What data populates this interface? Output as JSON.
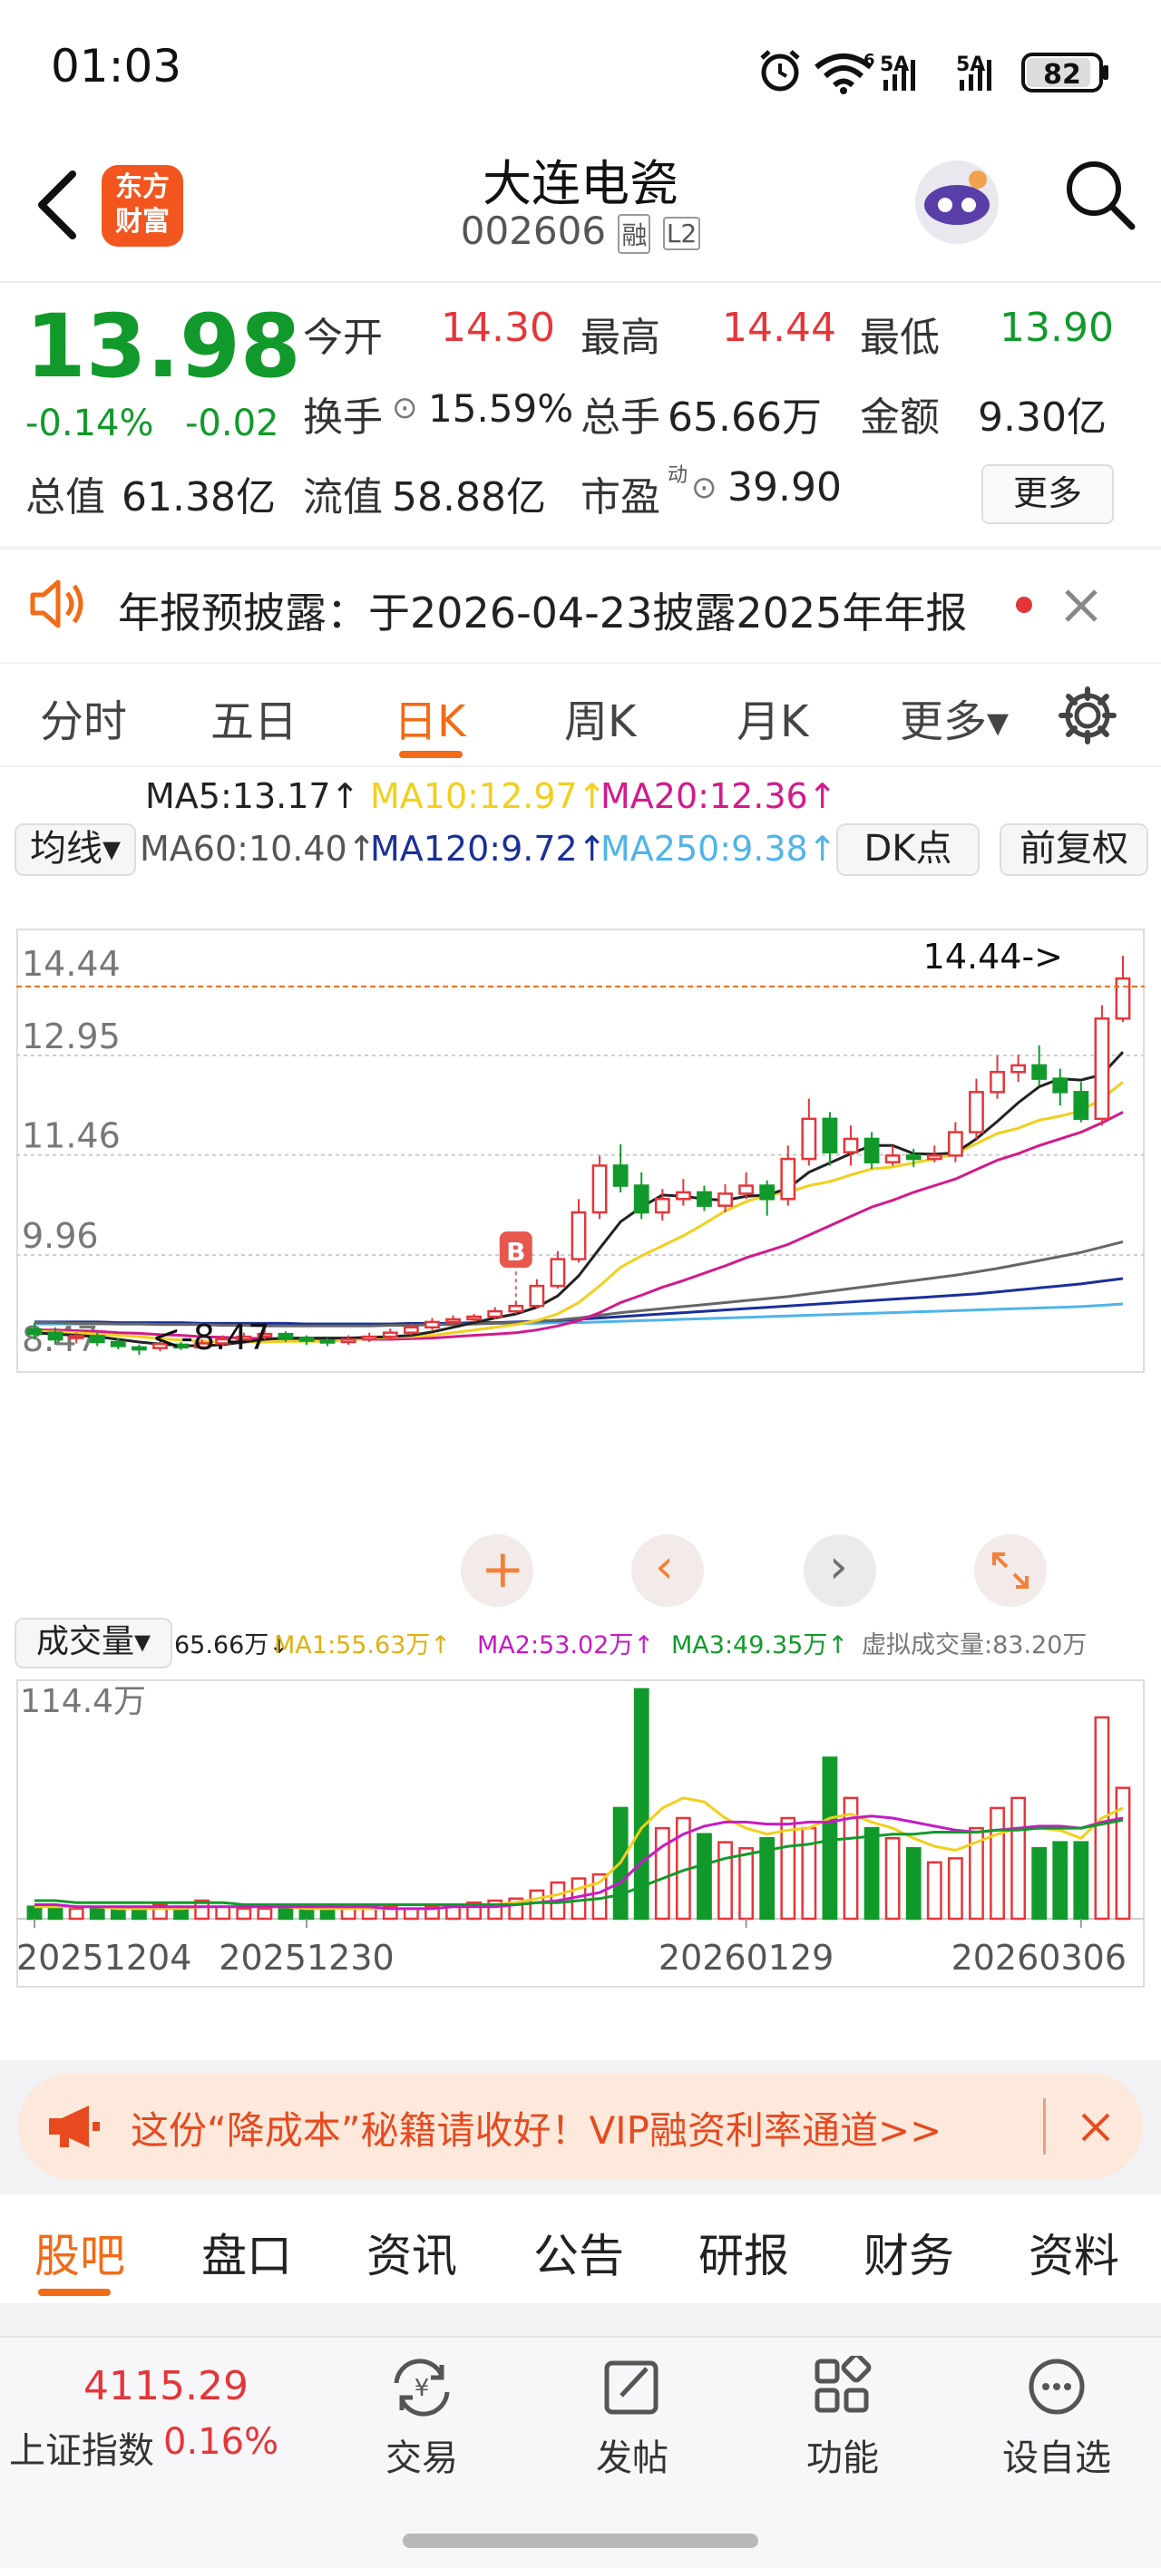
{
  "status_bar": {
    "time": "01:03",
    "battery": "82",
    "signal1": "5A",
    "signal2": "5A",
    "wifi_badge": "6"
  },
  "header": {
    "title": "大连电瓷",
    "code": "002606",
    "badge1": "融",
    "badge2": "L2",
    "logo_line1": "东方",
    "logo_line2": "财富"
  },
  "quote": {
    "price": "13.98",
    "change_pct": "-0.14%",
    "change": "-0.02",
    "open_label": "今开",
    "open": "14.30",
    "high_label": "最高",
    "high": "14.44",
    "low_label": "最低",
    "low": "13.90",
    "turnover_label": "换手",
    "turnover": "15.59%",
    "volume_label": "总手",
    "volume": "65.66万",
    "amount_label": "金额",
    "amount": "9.30亿",
    "mktcap_label": "总值",
    "mktcap": "61.38亿",
    "float_label": "流值",
    "float": "58.88亿",
    "pe_label": "市盈",
    "pe_sup": "动",
    "pe": "39.90",
    "more_button": "更多"
  },
  "notice": {
    "text": "年报预披露：于2026-04-23披露2025年年报"
  },
  "tabs": [
    "分时",
    "五日",
    "日K",
    "周K",
    "月K",
    "更多▾"
  ],
  "active_tab": 2,
  "ma_line1": {
    "ma5": "MA5:13.17↑",
    "ma10": "MA10:12.97↑",
    "ma20": "MA20:12.36↑"
  },
  "ma_line2": {
    "selector": "均线▾",
    "ma60": "MA60:10.40↑",
    "ma120": "MA120:9.72↑",
    "ma250": "MA250:9.38↑",
    "dk_button": "DK点",
    "adjust_button": "前复权"
  },
  "colors": {
    "up": "#e4363a",
    "down": "#119a2b",
    "ma5": "#222222",
    "ma10": "#f2cf1c",
    "ma20": "#d21a8c",
    "ma60": "#666666",
    "ma120": "#1a2f9a",
    "ma250": "#4fb4ea",
    "accent": "#f26b16"
  },
  "chart_data": {
    "type": "candlestick",
    "price_ticks": [
      "14.44",
      "12.95",
      "11.46",
      "9.96",
      "8.47"
    ],
    "ylim": [
      8.47,
      14.44
    ],
    "max_label": "14.44->",
    "min_label": "<-8.47",
    "buy_marker": "B",
    "candles": [
      [
        8.85,
        8.78,
        8.95,
        8.7
      ],
      [
        8.8,
        8.7,
        8.88,
        8.62
      ],
      [
        8.72,
        8.75,
        8.8,
        8.64
      ],
      [
        8.75,
        8.66,
        8.82,
        8.6
      ],
      [
        8.66,
        8.6,
        8.72,
        8.55
      ],
      [
        8.58,
        8.55,
        8.62,
        8.47
      ],
      [
        8.57,
        8.63,
        8.68,
        8.52
      ],
      [
        8.62,
        8.58,
        8.66,
        8.54
      ],
      [
        8.58,
        8.64,
        8.7,
        8.55
      ],
      [
        8.64,
        8.7,
        8.76,
        8.6
      ],
      [
        8.7,
        8.74,
        8.8,
        8.66
      ],
      [
        8.74,
        8.78,
        8.84,
        8.7
      ],
      [
        8.78,
        8.72,
        8.82,
        8.66
      ],
      [
        8.72,
        8.68,
        8.76,
        8.62
      ],
      [
        8.68,
        8.66,
        8.72,
        8.6
      ],
      [
        8.66,
        8.7,
        8.76,
        8.62
      ],
      [
        8.7,
        8.74,
        8.8,
        8.66
      ],
      [
        8.74,
        8.8,
        8.86,
        8.7
      ],
      [
        8.8,
        8.88,
        8.94,
        8.76
      ],
      [
        8.88,
        8.96,
        9.02,
        8.84
      ],
      [
        8.96,
        9.0,
        9.06,
        8.9
      ],
      [
        9.0,
        9.04,
        9.08,
        8.96
      ],
      [
        9.04,
        9.12,
        9.18,
        9.0
      ],
      [
        9.12,
        9.2,
        9.28,
        9.08
      ],
      [
        9.2,
        9.5,
        9.6,
        9.16
      ],
      [
        9.5,
        9.9,
        10.02,
        9.46
      ],
      [
        9.9,
        10.6,
        10.8,
        9.85
      ],
      [
        10.6,
        11.3,
        11.45,
        10.5
      ],
      [
        11.3,
        11.0,
        11.62,
        10.9
      ],
      [
        11.0,
        10.6,
        11.2,
        10.5
      ],
      [
        10.6,
        10.8,
        10.95,
        10.48
      ],
      [
        10.8,
        10.9,
        11.1,
        10.7
      ],
      [
        10.9,
        10.7,
        11.0,
        10.62
      ],
      [
        10.7,
        10.88,
        11.02,
        10.6
      ],
      [
        10.88,
        11.0,
        11.2,
        10.8
      ],
      [
        11.0,
        10.8,
        11.08,
        10.55
      ],
      [
        10.8,
        11.4,
        11.6,
        10.7
      ],
      [
        11.4,
        12.0,
        12.3,
        11.3
      ],
      [
        12.0,
        11.5,
        12.1,
        11.3
      ],
      [
        11.5,
        11.7,
        11.9,
        11.3
      ],
      [
        11.7,
        11.35,
        11.8,
        11.25
      ],
      [
        11.35,
        11.45,
        11.6,
        11.3
      ],
      [
        11.45,
        11.4,
        11.55,
        11.28
      ],
      [
        11.4,
        11.45,
        11.6,
        11.35
      ],
      [
        11.45,
        11.8,
        11.95,
        11.35
      ],
      [
        11.8,
        12.4,
        12.6,
        11.7
      ],
      [
        12.4,
        12.7,
        12.95,
        12.3
      ],
      [
        12.7,
        12.8,
        12.96,
        12.55
      ],
      [
        12.8,
        12.6,
        13.1,
        12.5
      ],
      [
        12.6,
        12.4,
        12.75,
        12.2
      ],
      [
        12.4,
        12.0,
        12.55,
        11.95
      ],
      [
        12.0,
        13.5,
        13.7,
        11.9
      ],
      [
        13.5,
        14.1,
        14.44,
        13.45
      ]
    ],
    "ma5": [
      8.8,
      8.78,
      8.76,
      8.74,
      8.7,
      8.66,
      8.63,
      8.61,
      8.6,
      8.62,
      8.66,
      8.7,
      8.72,
      8.72,
      8.72,
      8.72,
      8.73,
      8.74,
      8.76,
      8.81,
      8.88,
      8.95,
      9.02,
      9.08,
      9.18,
      9.35,
      9.65,
      10.06,
      10.46,
      10.68,
      10.86,
      10.84,
      10.8,
      10.78,
      10.84,
      10.86,
      10.96,
      11.2,
      11.34,
      11.48,
      11.6,
      11.6,
      11.48,
      11.47,
      11.49,
      11.7,
      11.96,
      12.24,
      12.48,
      12.6,
      12.58,
      12.66,
      13.0
    ],
    "ma10": [
      8.82,
      8.81,
      8.8,
      8.78,
      8.76,
      8.74,
      8.71,
      8.69,
      8.67,
      8.66,
      8.66,
      8.66,
      8.67,
      8.67,
      8.67,
      8.69,
      8.71,
      8.73,
      8.74,
      8.76,
      8.8,
      8.84,
      8.88,
      8.92,
      8.98,
      9.08,
      9.25,
      9.5,
      9.78,
      9.95,
      10.1,
      10.25,
      10.43,
      10.62,
      10.76,
      10.86,
      10.9,
      11.0,
      11.06,
      11.16,
      11.25,
      11.28,
      11.34,
      11.4,
      11.48,
      11.63,
      11.78,
      11.86,
      11.98,
      12.04,
      12.12,
      12.3,
      12.55
    ],
    "ma20": [
      8.84,
      8.84,
      8.83,
      8.82,
      8.8,
      8.79,
      8.77,
      8.76,
      8.74,
      8.73,
      8.72,
      8.71,
      8.71,
      8.7,
      8.7,
      8.7,
      8.7,
      8.7,
      8.71,
      8.72,
      8.74,
      8.76,
      8.78,
      8.8,
      8.84,
      8.9,
      8.98,
      9.1,
      9.25,
      9.36,
      9.48,
      9.58,
      9.69,
      9.8,
      9.92,
      10.02,
      10.12,
      10.26,
      10.4,
      10.54,
      10.68,
      10.78,
      10.9,
      11.0,
      11.1,
      11.24,
      11.38,
      11.48,
      11.6,
      11.7,
      11.8,
      11.94,
      12.1
    ],
    "ma60": [
      8.95,
      8.95,
      8.94,
      8.94,
      8.93,
      8.93,
      8.92,
      8.92,
      8.92,
      8.91,
      8.91,
      8.9,
      8.9,
      8.9,
      8.9,
      8.9,
      8.9,
      8.91,
      8.91,
      8.92,
      8.92,
      8.93,
      8.94,
      8.95,
      8.97,
      8.99,
      9.02,
      9.06,
      9.1,
      9.13,
      9.16,
      9.19,
      9.22,
      9.25,
      9.28,
      9.31,
      9.34,
      9.38,
      9.42,
      9.46,
      9.5,
      9.54,
      9.58,
      9.62,
      9.66,
      9.71,
      9.76,
      9.82,
      9.88,
      9.94,
      10.0,
      10.08,
      10.16
    ],
    "ma120": [
      8.96,
      8.96,
      8.96,
      8.96,
      8.95,
      8.95,
      8.95,
      8.95,
      8.94,
      8.94,
      8.94,
      8.94,
      8.94,
      8.93,
      8.93,
      8.93,
      8.93,
      8.93,
      8.94,
      8.94,
      8.94,
      8.95,
      8.95,
      8.96,
      8.97,
      8.98,
      9.0,
      9.02,
      9.04,
      9.06,
      9.08,
      9.1,
      9.12,
      9.14,
      9.16,
      9.18,
      9.2,
      9.22,
      9.24,
      9.26,
      9.28,
      9.3,
      9.32,
      9.34,
      9.36,
      9.38,
      9.41,
      9.44,
      9.47,
      9.5,
      9.53,
      9.57,
      9.61
    ],
    "ma250": [
      8.93,
      8.93,
      8.93,
      8.93,
      8.93,
      8.93,
      8.93,
      8.93,
      8.93,
      8.93,
      8.93,
      8.93,
      8.93,
      8.93,
      8.93,
      8.93,
      8.93,
      8.93,
      8.93,
      8.93,
      8.93,
      8.94,
      8.94,
      8.94,
      8.94,
      8.95,
      8.95,
      8.96,
      8.97,
      8.98,
      8.99,
      9.0,
      9.01,
      9.02,
      9.03,
      9.04,
      9.05,
      9.06,
      9.07,
      9.08,
      9.09,
      9.1,
      9.11,
      9.12,
      9.13,
      9.14,
      9.15,
      9.16,
      9.17,
      9.18,
      9.19,
      9.21,
      9.23
    ],
    "volume_label": "成交量▾",
    "volume_text": "65.66万↓",
    "vol_ma1": "MA1:55.63万↑",
    "vol_ma2": "MA2:53.02万↑",
    "vol_ma3": "MA3:49.35万↑",
    "virtual_volume": "虚拟成交量:83.20万",
    "volume_max_label": "114.4万",
    "volume_max": 114.4,
    "volumes": [
      6,
      5,
      5,
      5,
      5,
      6,
      7,
      6,
      9,
      6,
      5,
      5,
      5,
      5,
      5,
      5,
      5,
      6,
      5,
      6,
      7,
      8,
      9,
      10,
      14,
      18,
      20,
      22,
      55,
      114,
      45,
      50,
      42,
      38,
      35,
      40,
      50,
      45,
      80,
      60,
      45,
      40,
      35,
      28,
      30,
      45,
      55,
      60,
      35,
      38,
      38,
      100,
      65
    ],
    "vol_ma1_series": [
      6,
      6,
      6,
      6,
      5,
      5,
      5,
      5,
      6,
      6,
      6,
      6,
      6,
      5,
      5,
      5,
      5,
      5,
      5,
      5,
      6,
      6,
      7,
      8,
      10,
      12,
      15,
      18,
      28,
      45,
      55,
      60,
      58,
      50,
      45,
      42,
      44,
      45,
      50,
      52,
      48,
      45,
      40,
      36,
      34,
      38,
      42,
      45,
      45,
      44,
      40,
      50,
      55
    ],
    "vol_ma2_series": [
      7,
      7,
      6,
      6,
      6,
      6,
      6,
      6,
      6,
      6,
      6,
      6,
      6,
      6,
      6,
      6,
      6,
      5,
      5,
      5,
      6,
      6,
      6,
      7,
      8,
      9,
      11,
      13,
      18,
      28,
      36,
      42,
      46,
      48,
      48,
      47,
      47,
      48,
      48,
      50,
      51,
      50,
      48,
      46,
      44,
      43,
      44,
      45,
      46,
      46,
      45,
      48,
      50
    ],
    "vol_ma3_series": [
      9,
      9,
      8,
      8,
      8,
      8,
      8,
      8,
      8,
      8,
      7,
      7,
      7,
      7,
      7,
      7,
      7,
      7,
      7,
      7,
      7,
      7,
      7,
      7,
      8,
      8,
      9,
      10,
      12,
      16,
      20,
      24,
      27,
      30,
      32,
      34,
      36,
      37,
      39,
      40,
      41,
      42,
      42,
      43,
      43,
      43,
      44,
      44,
      45,
      45,
      45,
      47,
      49
    ],
    "dates": [
      "20251204",
      "20251230",
      "20260129",
      "20260306"
    ]
  },
  "promo": {
    "text": "这份“降成本”秘籍请收好！VIP融资利率通道>>"
  },
  "subtabs": [
    "股吧",
    "盘口",
    "资讯",
    "公告",
    "研报",
    "财务",
    "资料"
  ],
  "active_subtab": 0,
  "bottom_bar": {
    "index_value": "4115.29",
    "index_name": "上证指数",
    "index_change": "0.16%",
    "items": [
      "交易",
      "发帖",
      "功能",
      "设自选"
    ]
  }
}
